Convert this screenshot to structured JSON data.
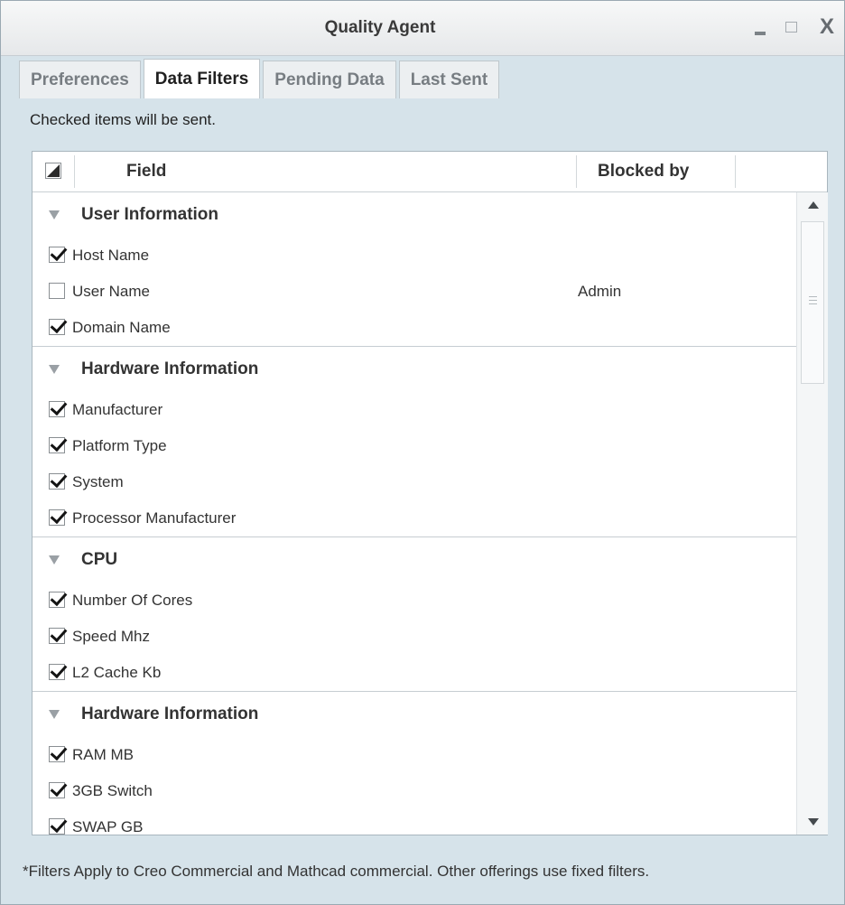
{
  "window": {
    "title": "Quality Agent",
    "minimize_label": "-",
    "close_label": "X"
  },
  "tabs": [
    {
      "label": "Preferences",
      "active": false
    },
    {
      "label": "Data Filters",
      "active": true
    },
    {
      "label": "Pending Data",
      "active": false
    },
    {
      "label": "Last Sent",
      "active": false
    }
  ],
  "hint": "Checked items will be sent.",
  "table": {
    "columns": {
      "field": "Field",
      "blocked_by": "Blocked by"
    },
    "groups": [
      {
        "title": "User Information",
        "rows": [
          {
            "label": "Host Name",
            "checked": true,
            "blocked_by": ""
          },
          {
            "label": "User Name",
            "checked": false,
            "blocked_by": "Admin"
          },
          {
            "label": "Domain Name",
            "checked": true,
            "blocked_by": ""
          }
        ]
      },
      {
        "title": "Hardware Information",
        "rows": [
          {
            "label": "Manufacturer",
            "checked": true,
            "blocked_by": ""
          },
          {
            "label": "Platform Type",
            "checked": true,
            "blocked_by": ""
          },
          {
            "label": "System",
            "checked": true,
            "blocked_by": ""
          },
          {
            "label": "Processor Manufacturer",
            "checked": true,
            "blocked_by": ""
          }
        ]
      },
      {
        "title": "CPU",
        "rows": [
          {
            "label": "Number Of Cores",
            "checked": true,
            "blocked_by": ""
          },
          {
            "label": "Speed Mhz",
            "checked": true,
            "blocked_by": ""
          },
          {
            "label": "L2 Cache Kb",
            "checked": true,
            "blocked_by": ""
          }
        ]
      },
      {
        "title": "Hardware Information",
        "rows": [
          {
            "label": "RAM MB",
            "checked": true,
            "blocked_by": ""
          },
          {
            "label": "3GB Switch",
            "checked": true,
            "blocked_by": ""
          },
          {
            "label": "SWAP GB",
            "checked": true,
            "blocked_by": ""
          }
        ]
      }
    ]
  },
  "footer": "*Filters Apply to Creo Commercial and Mathcad commercial. Other offerings use fixed filters."
}
